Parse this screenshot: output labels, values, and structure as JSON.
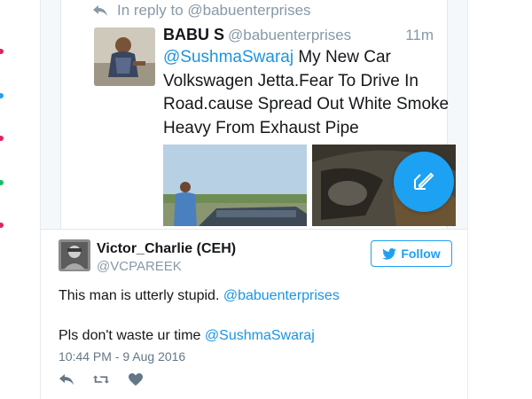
{
  "colors": {
    "accent": "#1da1f2",
    "mention": "#1b95e0",
    "muted": "#8899a6"
  },
  "edge_dots": [
    {
      "color": "#e0245e"
    },
    {
      "color": "#1da1f2"
    },
    {
      "color": "#e0245e"
    },
    {
      "color": "#17bf63"
    },
    {
      "color": "#e0245e"
    }
  ],
  "quoted_tweet": {
    "reply_context": "In reply to @babuenterprises",
    "author_name": "BABU S",
    "author_handle": "@babuenterprises",
    "time": "11m",
    "mention": "@SushmaSwaraj",
    "text": " My New Car Volkswagen Jetta.Fear To Drive In Road.cause Spread Out White Smoke Heavy From Exhaust Pipe",
    "icons": {
      "reply": "reply-icon",
      "compose": "compose-icon"
    }
  },
  "tweet": {
    "author_name": "Victor_Charlie (CEH)",
    "author_handle": "@VCPAREEK",
    "follow_label": "Follow",
    "line1_text": "This man is utterly stupid. ",
    "line1_mention": "@babuenterprises",
    "line2_text": "Pls don't waste ur time ",
    "line2_mention": "@SushmaSwaraj",
    "timestamp": "10:44 PM - 9 Aug 2016",
    "actions": [
      "reply-icon",
      "retweet-icon",
      "like-icon"
    ]
  }
}
